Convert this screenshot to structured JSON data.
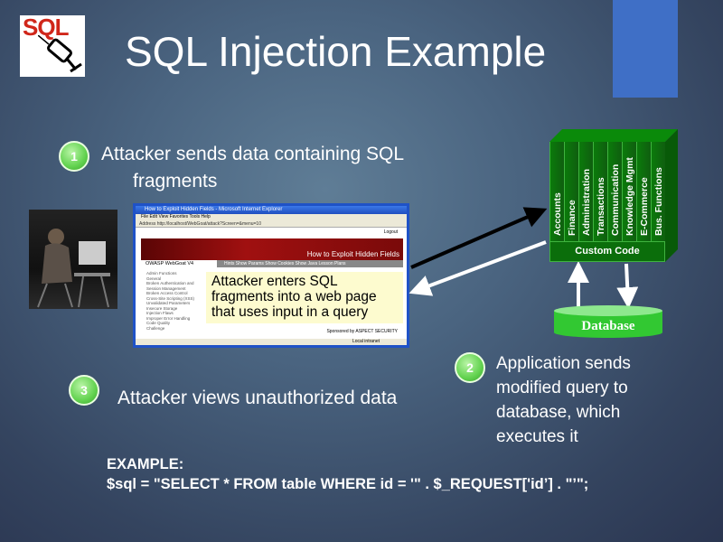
{
  "title": "SQL Injection Example",
  "logo": {
    "text": "SQL",
    "icon": "syringe-icon"
  },
  "steps": [
    {
      "number": "1",
      "text_line1": "Attacker sends data containing SQL",
      "text_line2": "fragments"
    },
    {
      "number": "2",
      "text": [
        "Application sends",
        "modified query to",
        "database, which",
        "executes it"
      ]
    },
    {
      "number": "3",
      "text": "Attacker views unauthorized data"
    }
  ],
  "browser": {
    "window_title": "How to Exploit Hidden Fields - Microsoft Internet Explorer",
    "menu": "File  Edit  View  Favorites  Tools  Help",
    "address": "Address  http://localhost/WebGoat/attack?Screen=&menu=10",
    "logout": "Logout",
    "banner": "How to Exploit Hidden Fields",
    "brand": "OWASP WebGoat V4",
    "nav": "Hints  Show Params  Show Cookies  Show Java  Lesson Plans",
    "left_nav": [
      "Admin Functions",
      "General",
      "Broken Authentication and Session Management",
      "Broken Access Control",
      "Cross-Site Scripting (XSS)",
      "Unvalidated Parameters",
      "Insecure Storage",
      "Injection Flaws",
      "Improper Error Handling",
      "Code Quality",
      "Challenge"
    ],
    "callout": "Attacker enters SQL fragments into a web page that uses input in a query",
    "sponsor": "Sponsored by ASPECT SECURITY",
    "status": "Local intranet"
  },
  "app_stack": {
    "modules": [
      "Accounts",
      "Finance",
      "Administration",
      "Transactions",
      "Communication",
      "Knowledge Mgmt",
      "E-Commerce",
      "Bus. Functions"
    ],
    "base": "Custom Code"
  },
  "database": "Database",
  "example": {
    "label": "EXAMPLE:",
    "code": "$sql = \"SELECT * FROM table WHERE id = '\" . $_REQUEST['id’] . \"’\";"
  }
}
